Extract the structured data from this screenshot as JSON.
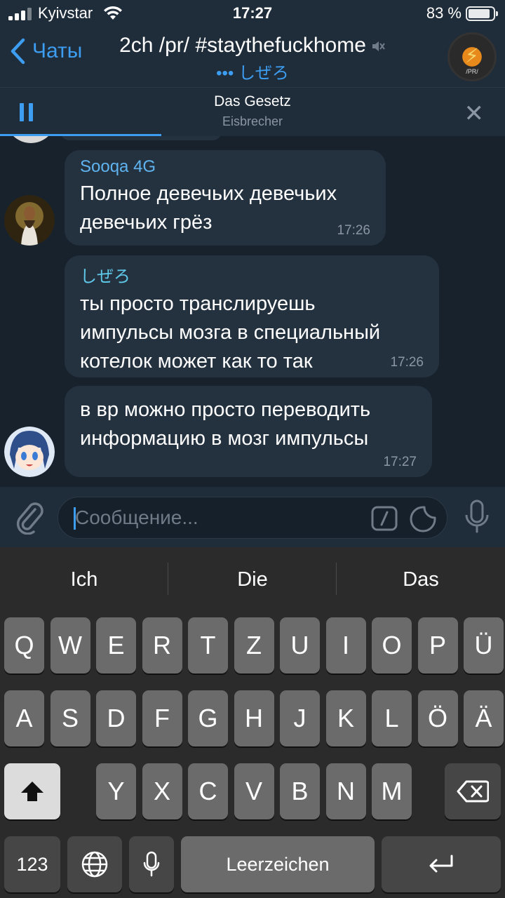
{
  "status_bar": {
    "carrier": "Kyivstar",
    "time": "17:27",
    "battery": "83 %"
  },
  "header": {
    "back_label": "Чаты",
    "title": "2ch /pr/ #staythefuckhome",
    "typing": "••• しぜろ",
    "avatar_tag": "/PR/"
  },
  "player": {
    "track": "Das Gesetz",
    "artist": "Eisbrecher",
    "progress": 0.32
  },
  "messages": [
    {
      "sender": "Sooqa 4G",
      "sender_color": "#5fb4f0",
      "text_lines": [
        "Полное девечьих девечьих",
        "девечьих грёз"
      ],
      "time": "17:26"
    },
    {
      "sender": "しぜろ",
      "sender_color": "#5fc8e8",
      "text_lines": [
        "ты просто транслируешь",
        "импульсы мозга в специальный",
        "котелок может как то так"
      ],
      "time": "17:26"
    },
    {
      "sender": "",
      "text_lines": [
        "в вр можно просто переводить",
        "информацию в мозг импульсы"
      ],
      "time": "17:27"
    }
  ],
  "input": {
    "placeholder": "Сообщение..."
  },
  "keyboard": {
    "suggestions": [
      "Ich",
      "Die",
      "Das"
    ],
    "row1": [
      "Q",
      "W",
      "E",
      "R",
      "T",
      "Z",
      "U",
      "I",
      "O",
      "P",
      "Ü"
    ],
    "row2": [
      "A",
      "S",
      "D",
      "F",
      "G",
      "H",
      "J",
      "K",
      "L",
      "Ö",
      "Ä"
    ],
    "row3": [
      "Y",
      "X",
      "C",
      "V",
      "B",
      "N",
      "M"
    ],
    "numbers_label": "123",
    "space_label": "Leerzeichen"
  },
  "colors": {
    "accent": "#3d9df0",
    "bubble": "#243240",
    "background": "#18222d"
  }
}
